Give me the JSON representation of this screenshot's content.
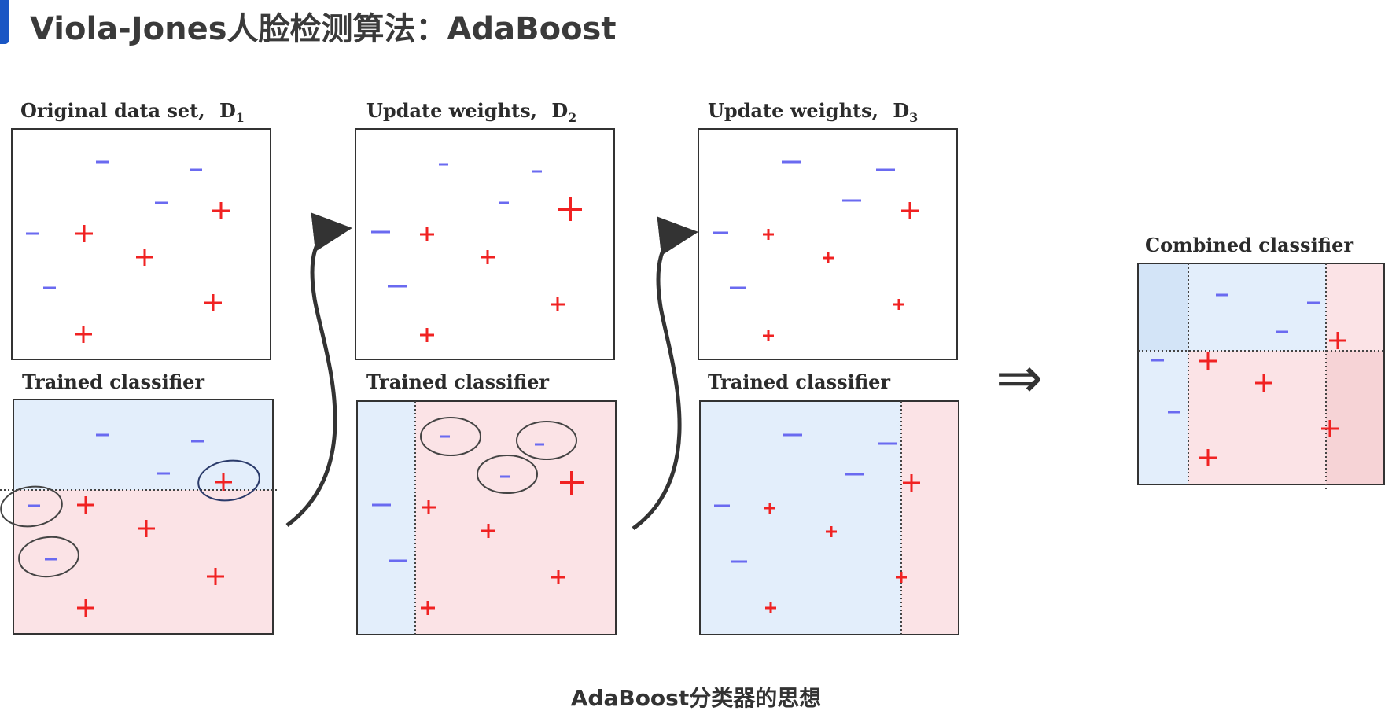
{
  "slide": {
    "title": "Viola-Jones人脸检测算法：AdaBoost",
    "caption": "AdaBoost分类器的思想"
  },
  "panels": {
    "d1_title": "Original data set,",
    "d1_var": "D",
    "d1_sub": "1",
    "d2_title": "Update weights,",
    "d2_var": "D",
    "d2_sub": "2",
    "d3_title": "Update weights,",
    "d3_var": "D",
    "d3_sub": "3",
    "trained_1": "Trained classifier",
    "trained_2": "Trained classifier",
    "trained_3": "Trained classifier",
    "combined": "Combined classifier"
  },
  "symbols": {
    "plus": "+",
    "minus": "−",
    "implies": "⇒"
  },
  "colors": {
    "negative_region": "#e3eefb",
    "positive_region": "#fbe3e6",
    "negative_point": "#6a6af0",
    "positive_point": "#f02222",
    "title_accent": "#1a56c4"
  },
  "weights": {
    "d2_emphasized": [
      "top-left minus circled",
      "top-right minus circled",
      "middle minus circled",
      "top-right plus"
    ],
    "d3_emphasized": [
      "left minus points",
      "top-right plus"
    ]
  }
}
